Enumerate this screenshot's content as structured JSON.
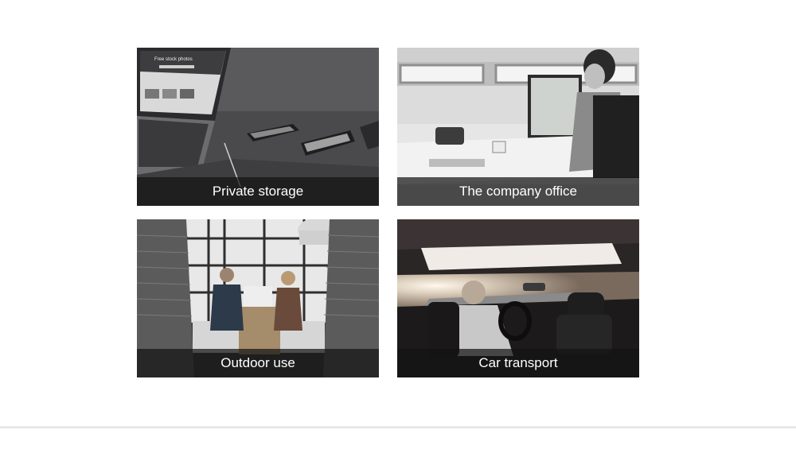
{
  "tiles": [
    {
      "caption": "Private storage",
      "image": "laptop-and-phones-photo"
    },
    {
      "caption": "The company office",
      "image": "office-worker-at-desk-photo"
    },
    {
      "caption": "Outdoor use",
      "image": "people-with-laptop-in-booth-photo"
    },
    {
      "caption": "Car transport",
      "image": "car-interior-driver-photo"
    }
  ],
  "laptop_screen_text": "Free stock photos"
}
